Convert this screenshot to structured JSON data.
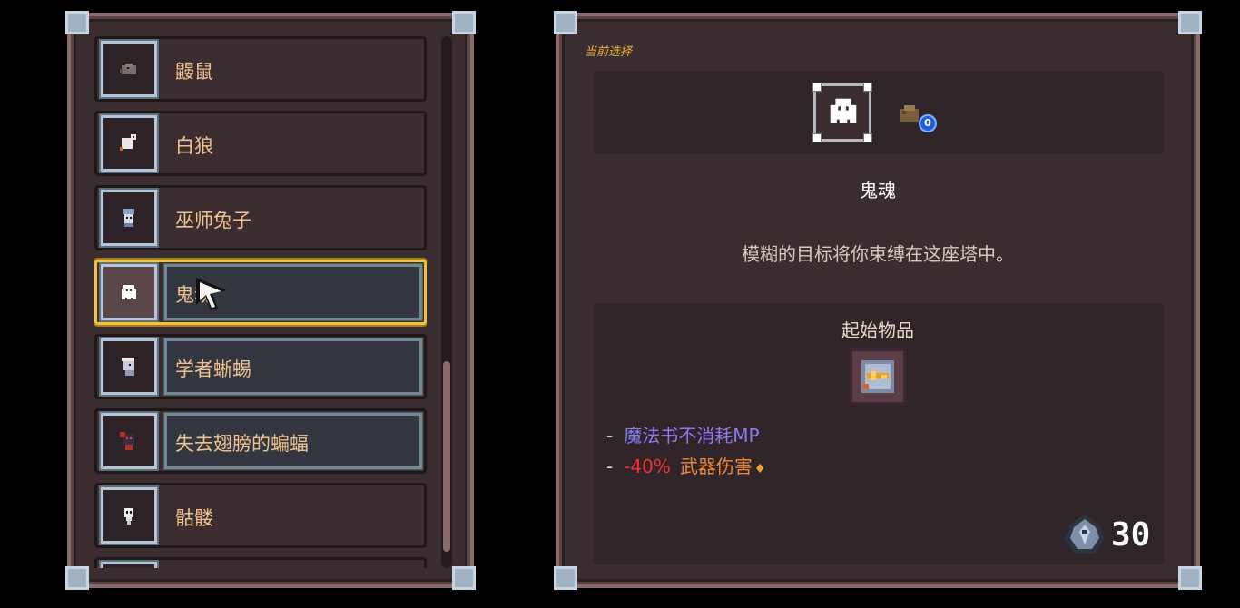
{
  "character_list": [
    {
      "name": "鼹鼠",
      "icon": "mole-icon"
    },
    {
      "name": "白狼",
      "icon": "white-wolf-icon"
    },
    {
      "name": "巫师兔子",
      "icon": "wizard-rabbit-icon"
    },
    {
      "name": "鬼魂",
      "icon": "ghost-icon",
      "selected": true
    },
    {
      "name": "学者蜥蜴",
      "icon": "scholar-lizard-icon"
    },
    {
      "name": "失去翅膀的蝙蝠",
      "icon": "wingless-bat-icon"
    },
    {
      "name": "骷髅",
      "icon": "skeleton-icon"
    }
  ],
  "detail": {
    "current_selection_label": "当前选择",
    "character_name": "鬼魂",
    "description": "模糊的目标将你束缚在这座塔中。",
    "pet_badge": "0",
    "starting_items_title": "起始物品",
    "starting_item_icon": "spellbook-icon",
    "perks": [
      {
        "text": "魔法书不消耗MP"
      },
      {
        "value": "-40%",
        "text": "武器伤害"
      }
    ],
    "cost": "30",
    "cost_icon": "soul-crystal-icon"
  },
  "colors": {
    "selected_border": "#f2c23a",
    "perk_blue": "#8a7cf0",
    "perk_red": "#f03232",
    "perk_orange": "#f08a3a"
  }
}
